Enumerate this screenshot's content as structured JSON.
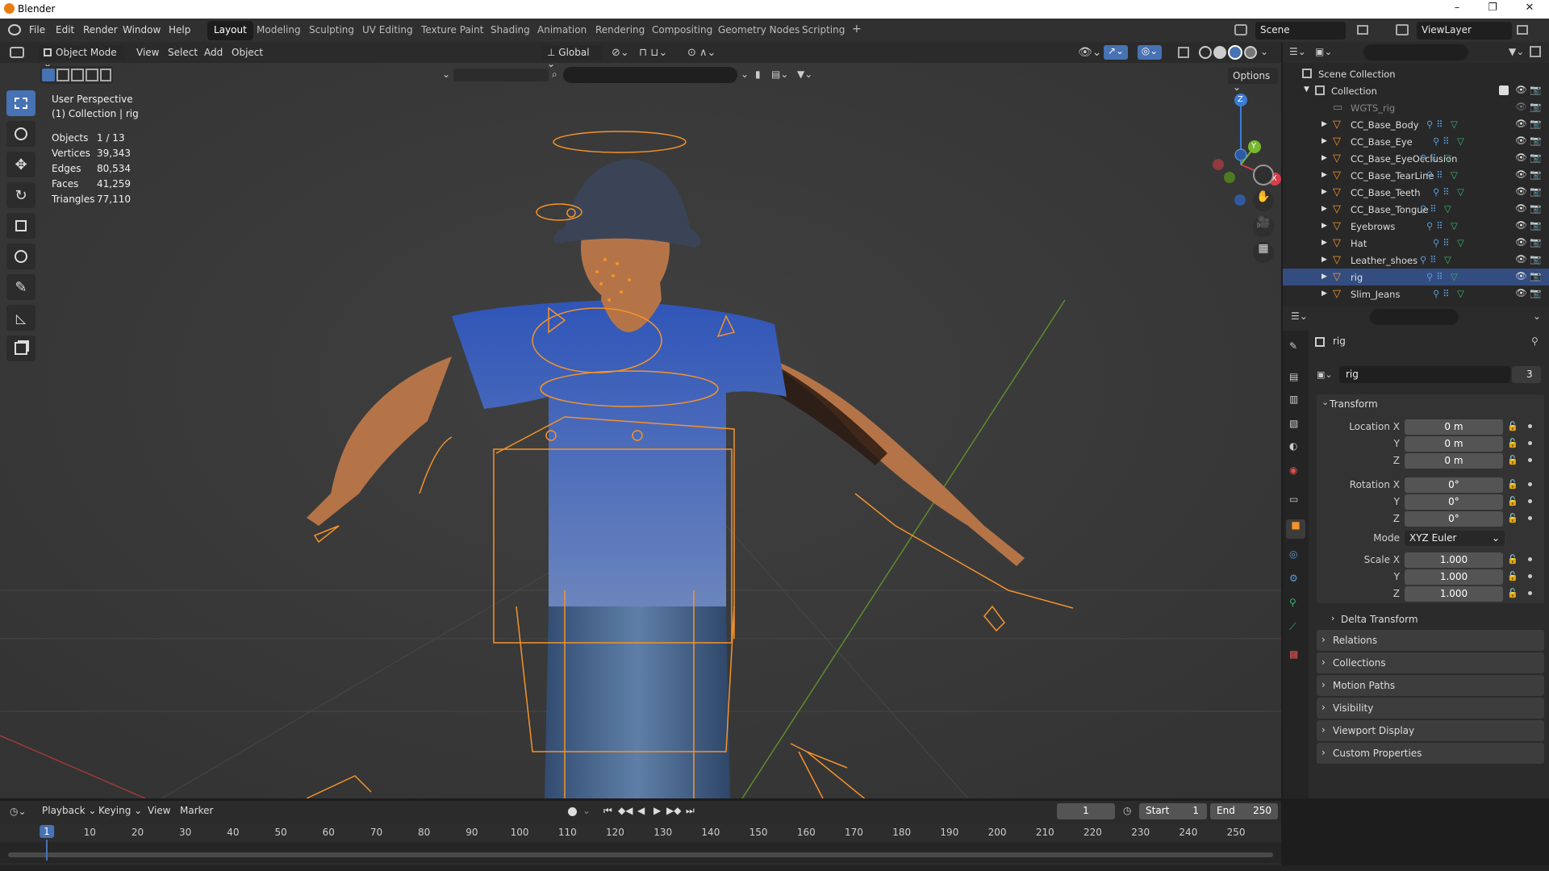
{
  "window": {
    "title": "Blender",
    "min": "–",
    "max": "❐",
    "close": "✕"
  },
  "menu": [
    "File",
    "Edit",
    "Render",
    "Window",
    "Help"
  ],
  "workspaces": [
    "Layout",
    "Modeling",
    "Sculpting",
    "UV Editing",
    "Texture Paint",
    "Shading",
    "Animation",
    "Rendering",
    "Compositing",
    "Geometry Nodes",
    "Scripting",
    "+"
  ],
  "scene_field": "Scene",
  "viewlayer_field": "ViewLayer",
  "viewport_header": {
    "mode": "Object Mode",
    "menus": [
      "View",
      "Select",
      "Add",
      "Object"
    ],
    "orientation": "Global",
    "options": "Options"
  },
  "viewport_info": {
    "line1": "User Perspective",
    "line2": "(1) Collection | rig"
  },
  "stats": [
    {
      "label": "Objects",
      "value": "1 / 13"
    },
    {
      "label": "Vertices",
      "value": "39,343"
    },
    {
      "label": "Edges",
      "value": "80,534"
    },
    {
      "label": "Faces",
      "value": "41,259"
    },
    {
      "label": "Triangles",
      "value": "77,110"
    }
  ],
  "gizmo": {
    "x": "X",
    "y": "Y",
    "z": "Z"
  },
  "outliner": {
    "scene_collection": "Scene Collection",
    "collection": "Collection",
    "items": [
      "WGTS_rig",
      "CC_Base_Body",
      "CC_Base_Eye",
      "CC_Base_EyeOcclusion",
      "CC_Base_TearLine",
      "CC_Base_Teeth",
      "CC_Base_Tongue",
      "Eyebrows",
      "Hat",
      "Leather_shoes",
      "rig",
      "Slim_Jeans"
    ],
    "selected": "rig"
  },
  "properties": {
    "object_name": "rig",
    "data_name": "rig",
    "user_count": "3",
    "transform_label": "Transform",
    "location": {
      "label": "Location X",
      "x": "0 m",
      "y": "0 m",
      "z": "0 m"
    },
    "rotation": {
      "label": "Rotation X",
      "x": "0°",
      "y": "0°",
      "z": "0°"
    },
    "mode_label": "Mode",
    "mode_value": "XYZ Euler",
    "scale": {
      "label": "Scale X",
      "x": "1.000",
      "y": "1.000",
      "z": "1.000"
    },
    "axis_y": "Y",
    "axis_z": "Z",
    "delta": "Delta Transform",
    "panels": [
      "Relations",
      "Collections",
      "Motion Paths",
      "Visibility",
      "Viewport Display",
      "Custom Properties"
    ]
  },
  "timeline": {
    "menus": [
      "Playback",
      "Keying",
      "View",
      "Marker"
    ],
    "current_frame": "1",
    "start_label": "Start",
    "start": "1",
    "end_label": "End",
    "end": "250",
    "ruler": [
      "1",
      "10",
      "20",
      "30",
      "40",
      "50",
      "60",
      "70",
      "80",
      "90",
      "100",
      "110",
      "120",
      "130",
      "140",
      "150",
      "160",
      "170",
      "180",
      "190",
      "200",
      "210",
      "220",
      "230",
      "240",
      "250"
    ]
  },
  "colors": {
    "accent": "#4772b3",
    "selection": "#f5932a",
    "bg_viewport": "#393939"
  }
}
